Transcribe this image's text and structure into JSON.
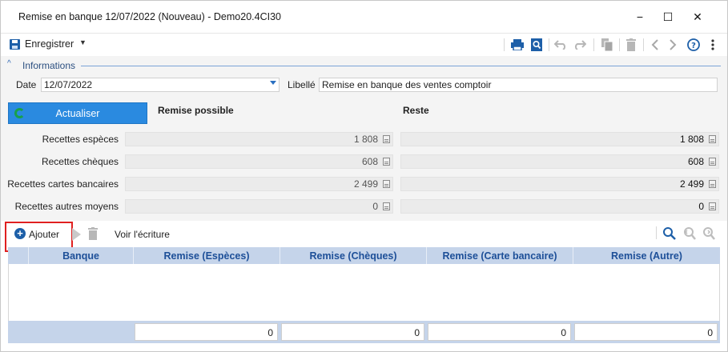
{
  "window": {
    "title": "Remise en banque 12/07/2022 (Nouveau) - Demo20.4CI30",
    "minimize": "−",
    "maximize": "☐",
    "close": "✕"
  },
  "toolbar": {
    "save_label": "Enregistrer",
    "save_caret": "▼",
    "icons": [
      "print-icon",
      "print-preview-icon",
      "undo-icon",
      "redo-icon",
      "copy-icon",
      "delete-icon",
      "previous-icon",
      "next-icon",
      "help-icon",
      "more-icon"
    ]
  },
  "section": {
    "chevron": "^",
    "label": "Informations"
  },
  "form": {
    "date_label": "Date",
    "date_value": "12/07/2022",
    "libelle_label": "Libellé",
    "libelle_value": "Remise en banque des ventes comptoir",
    "refresh_label": "Actualiser",
    "col_possible": "Remise possible",
    "col_reste": "Reste",
    "rows": [
      {
        "label": "Recettes espèces",
        "possible": "1 808",
        "reste": "1 808"
      },
      {
        "label": "Recettes chèques",
        "possible": "608",
        "reste": "608"
      },
      {
        "label": "Recettes cartes bancaires",
        "possible": "2 499",
        "reste": "2 499"
      },
      {
        "label": "Recettes autres moyens",
        "possible": "0",
        "reste": "0"
      }
    ]
  },
  "actions": {
    "add_label": "Ajouter",
    "voir_label": "Voir l'écriture"
  },
  "grid": {
    "headers": [
      "Banque",
      "Remise (Espèces)",
      "Remise (Chèques)",
      "Remise (Carte bancaire)",
      "Remise (Autre)"
    ],
    "totals": [
      "0",
      "0",
      "0",
      "0"
    ]
  },
  "colors": {
    "accent": "#2a8ae0",
    "header_bg": "#c5d4ea",
    "header_text": "#1d4f98",
    "highlight": "#e02020"
  }
}
